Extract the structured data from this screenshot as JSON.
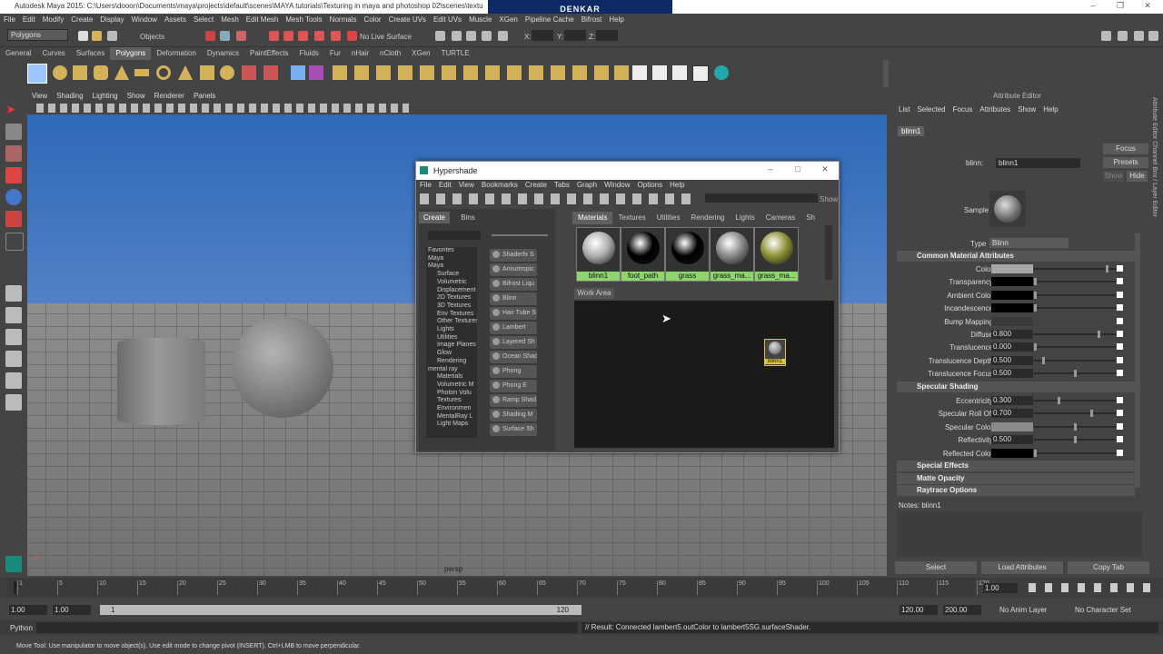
{
  "window": {
    "title": "Autodesk Maya 2015: C:\\Users\\dooon\\Documents\\maya\\projects\\default\\scenes\\MAYA tutorials\\Texturing in maya  and photoshop 02\\scenes\\textu",
    "logo": "DENKAR"
  },
  "menu": [
    "File",
    "Edit",
    "Modify",
    "Create",
    "Display",
    "Window",
    "Assets",
    "Select",
    "Mesh",
    "Edit Mesh",
    "Mesh Tools",
    "Normals",
    "Color",
    "Create UVs",
    "Edit UVs",
    "Muscle",
    "XGen",
    "Pipeline Cache",
    "Bifrost",
    "Help"
  ],
  "toolbar": {
    "mode": "Polygons",
    "objects": "Objects",
    "live_surface": "No Live Surface",
    "x": "X:",
    "y": "Y:",
    "z": "Z:"
  },
  "shelf_tabs": [
    "General",
    "Curves",
    "Surfaces",
    "Polygons",
    "Deformation",
    "Dynamics",
    "PaintEffects",
    "Fluids",
    "Fur",
    "nHair",
    "nCloth",
    "XGen",
    "TURTLE"
  ],
  "shelf_active": "Polygons",
  "viewport": {
    "menu": [
      "View",
      "Shading",
      "Lighting",
      "Show",
      "Renderer",
      "Panels"
    ],
    "camera": "persp"
  },
  "hypershade": {
    "title": "Hypershade",
    "menu": [
      "File",
      "Edit",
      "View",
      "Bookmarks",
      "Create",
      "Tabs",
      "Graph",
      "Window",
      "Options",
      "Help"
    ],
    "show_label": "Show",
    "left_tabs": [
      "Create",
      "Bins"
    ],
    "tree": [
      "Favorites",
      "Maya",
      "Maya",
      "Surface",
      "Volumetric",
      "Displacement",
      "2D Textures",
      "3D Textures",
      "Env Textures",
      "Other Textures",
      "Lights",
      "Utilities",
      "Image Planes",
      "Glow",
      "Rendering",
      "mental ray",
      "Materials",
      "Volumetric M",
      "Photon Volu",
      "Textures",
      "Environmen",
      "MentalRay L",
      "Light Maps"
    ],
    "nodes": [
      "Shaderfx S",
      "Anisotropic",
      "Bifrost Liqu",
      "Blinn",
      "Hair Tube S",
      "Lambert",
      "Layered Sh",
      "Ocean Shad",
      "Phong",
      "Phong E",
      "Ramp Shad",
      "Shading M",
      "Surface Sh"
    ],
    "tabs": [
      "Materials",
      "Textures",
      "Utilities",
      "Rendering",
      "Lights",
      "Cameras",
      "Sh"
    ],
    "materials": [
      {
        "name": "blinn1",
        "color": "#b0b0b0"
      },
      {
        "name": "foot_path",
        "color": "#000000"
      },
      {
        "name": "grass",
        "color": "#000000"
      },
      {
        "name": "grass_ma...",
        "color": "#8a8a8a"
      },
      {
        "name": "grass_ma...",
        "color": "#8e9236"
      }
    ],
    "work_area_label": "Work Area",
    "work_node": "blinn1"
  },
  "attribute_editor": {
    "title": "Attribute Editor",
    "menu": [
      "List",
      "Selected",
      "Focus",
      "Attributes",
      "Show",
      "Help"
    ],
    "node_tab": "blinn1",
    "name_label": "blinn:",
    "name_value": "blinn1",
    "focus_btn": "Focus",
    "presets_btn": "Presets",
    "show_btn": "Show",
    "hide_btn": "Hide",
    "sample_label": "Sample",
    "type_label": "Type",
    "type_value": "Blinn",
    "common": "Common Material Attributes",
    "common_rows": [
      {
        "label": "Color",
        "value": "",
        "knob": 0.9
      },
      {
        "label": "Transparency",
        "value": "",
        "knob": 0.0
      },
      {
        "label": "Ambient Color",
        "value": "",
        "knob": 0.0
      },
      {
        "label": "Incandescence",
        "value": "",
        "knob": 0.0
      },
      {
        "label": "Bump Mapping",
        "value": "",
        "knob": -1
      },
      {
        "label": "Diffuse",
        "value": "0.800",
        "knob": 0.8
      },
      {
        "label": "Translucence",
        "value": "0.000",
        "knob": 0.0
      },
      {
        "label": "Translucence Depth",
        "value": "0.500",
        "knob": 0.1
      },
      {
        "label": "Translucence Focus",
        "value": "0.500",
        "knob": 0.5
      }
    ],
    "specular": "Specular Shading",
    "specular_rows": [
      {
        "label": "Eccentricity",
        "value": "0.300",
        "knob": 0.3
      },
      {
        "label": "Specular Roll Off",
        "value": "0.700",
        "knob": 0.7
      },
      {
        "label": "Specular Color",
        "value": "",
        "knob": 0.5
      },
      {
        "label": "Reflectivity",
        "value": "0.500",
        "knob": 0.5
      },
      {
        "label": "Reflected Color",
        "value": "",
        "knob": 0.0
      }
    ],
    "collapsed": [
      "Special Effects",
      "Matte Opacity",
      "Raytrace Options"
    ],
    "notes": "Notes:  blinn1",
    "buttons": [
      "Select",
      "Load Attributes",
      "Copy Tab"
    ],
    "side_tabs": "Attribute Editor   Channel Box / Layer Editor"
  },
  "timeline": {
    "ticks": [
      "1",
      "5",
      "10",
      "15",
      "20",
      "25",
      "30",
      "35",
      "40",
      "45",
      "50",
      "55",
      "60",
      "65",
      "70",
      "75",
      "80",
      "85",
      "90",
      "95",
      "100",
      "105",
      "110",
      "115",
      "120"
    ],
    "current": "1.00"
  },
  "range": {
    "start": "1.00",
    "start2": "1.00",
    "in": "1",
    "out": "120",
    "end": "120.00",
    "end2": "200.00",
    "anim_layer": "No Anim Layer",
    "char_set": "No Character Set"
  },
  "command": {
    "lang": "Python",
    "result": "// Result: Connected lambert5.outColor to lambert5SG.surfaceShader."
  },
  "help": "Move Tool: Use manipulator to move object(s). Use edit mode to change pivot (INSERT).  Ctrl+LMB to move perpendicular."
}
